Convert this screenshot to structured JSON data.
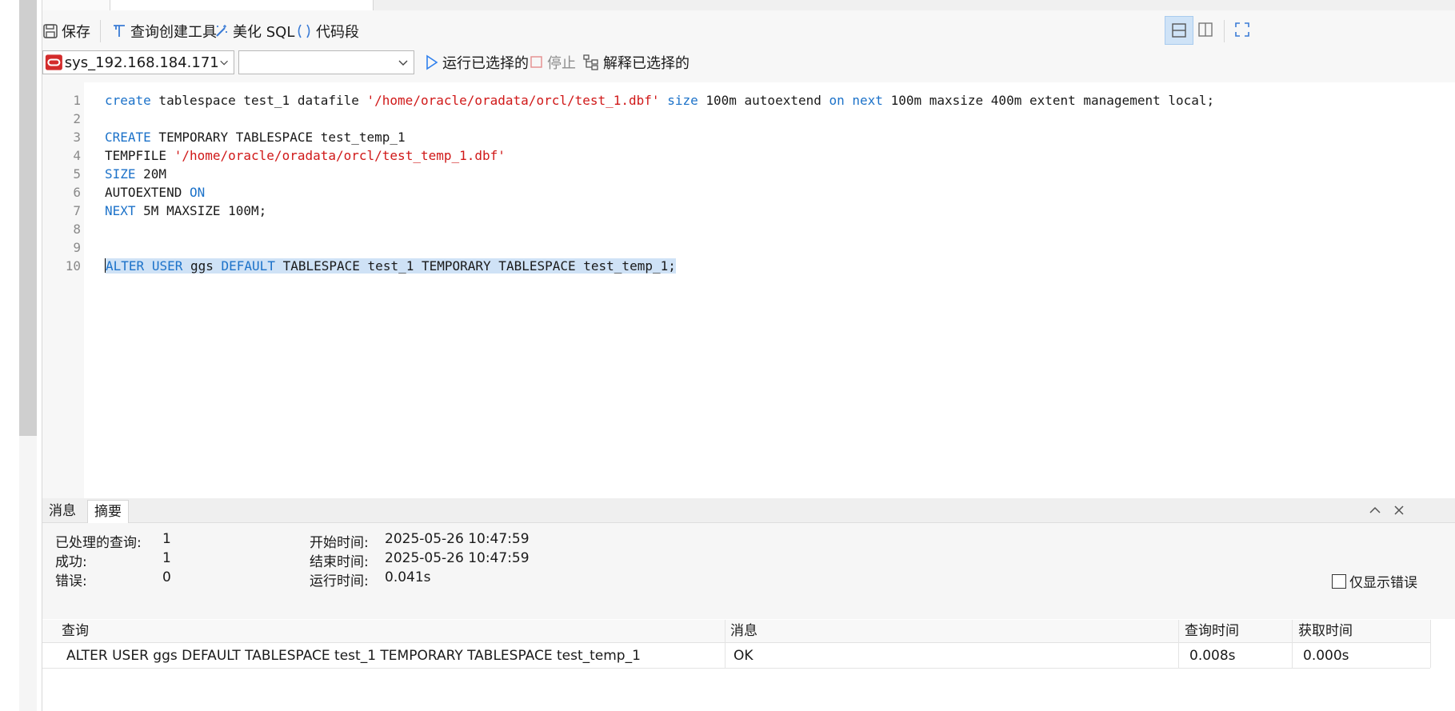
{
  "toolbar": {
    "save": "保存",
    "query_builder": "查询创建工具",
    "beautify": "美化 SQL",
    "snippet": "代码段"
  },
  "toolbar2": {
    "connection": "sys_192.168.184.171",
    "schema": "",
    "run_selected": "运行已选择的",
    "stop": "停止",
    "explain_selected": "解释已选择的"
  },
  "editor": {
    "line_numbers": [
      "1",
      "2",
      "3",
      "4",
      "5",
      "6",
      "7",
      "8",
      "9",
      "10"
    ],
    "line1": {
      "kw1": "create",
      "t1": " tablespace test_1 datafile ",
      "s1": "'/home/oracle/oradata/orcl/test_1.dbf'",
      "t2": " ",
      "kw2": "size",
      "t3": " 100m autoextend ",
      "kw3": "on",
      "t4": " ",
      "kw4": "next",
      "t5": " 100m maxsize 400m extent management local;"
    },
    "line3": {
      "kw1": "CREATE",
      "t1": " TEMPORARY TABLESPACE test_temp_1"
    },
    "line4": {
      "t1": "TEMPFILE ",
      "s1": "'/home/oracle/oradata/orcl/test_temp_1.dbf'"
    },
    "line5": {
      "kw1": "SIZE",
      "t1": " 20M"
    },
    "line6": {
      "t1": "AUTOEXTEND ",
      "kw1": "ON"
    },
    "line7": {
      "kw1": "NEXT",
      "t1": " 5M MAXSIZE 100M;"
    },
    "line10": {
      "kw1": "ALTER",
      "t1": " ",
      "kw2": "USER",
      "t2": " ggs ",
      "kw3": "DEFAULT",
      "t3": " TABLESPACE test_1 TEMPORARY TABLESPACE test_temp_1;"
    }
  },
  "bottom": {
    "tabs": [
      "消息",
      "摘要"
    ],
    "summary": {
      "processed_label": "已处理的查询:",
      "processed_value": "1",
      "success_label": "成功:",
      "success_value": "1",
      "error_label": "错误:",
      "error_value": "0",
      "start_label": "开始时间:",
      "start_value": "2025-05-26 10:47:59",
      "end_label": "结束时间:",
      "end_value": "2025-05-26 10:47:59",
      "elapsed_label": "运行时间:",
      "elapsed_value": "0.041s",
      "errors_only_label": "仅显示错误"
    },
    "grid": {
      "headers": [
        "查询",
        "消息",
        "查询时间",
        "获取时间"
      ],
      "rows": [
        [
          "ALTER USER ggs DEFAULT TABLESPACE test_1 TEMPORARY TABLESPACE test_temp_1",
          "OK",
          "0.008s",
          "0.000s"
        ]
      ]
    }
  },
  "colors": {
    "keyword": "#1c72c9",
    "string": "#d01818",
    "selection": "#cfe2f6"
  }
}
